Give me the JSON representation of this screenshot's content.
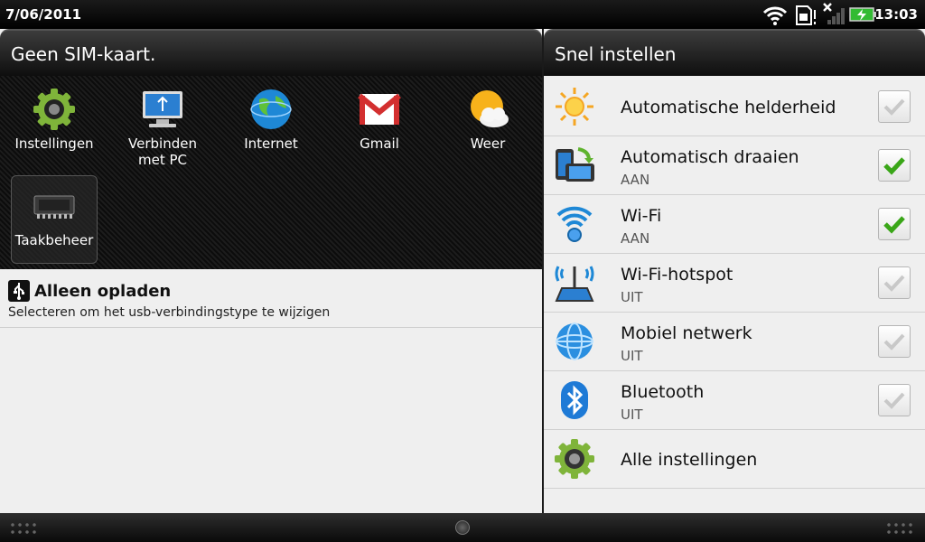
{
  "status_bar": {
    "date": "7/06/2011",
    "time": "13:03",
    "icons": [
      "wifi-icon",
      "sim-card-alert-icon",
      "no-signal-icon",
      "battery-charging-icon"
    ]
  },
  "left_panel": {
    "header": "Geen SIM-kaart.",
    "apps": [
      {
        "label": "Instellingen",
        "icon": "gear-icon"
      },
      {
        "label": "Verbinden met PC",
        "icon": "monitor-usb-icon"
      },
      {
        "label": "Internet",
        "icon": "globe-icon"
      },
      {
        "label": "Gmail",
        "icon": "gmail-icon"
      },
      {
        "label": "Weer",
        "icon": "weather-sun-cloud-icon"
      },
      {
        "label": "Taakbeheer",
        "icon": "memory-chip-icon"
      }
    ],
    "notification": {
      "title": "Alleen opladen",
      "subtitle": "Selecteren om het usb-verbindingstype te wijzigen",
      "icon": "usb-icon"
    }
  },
  "right_panel": {
    "header": "Snel instellen",
    "rows": [
      {
        "title": "Automatische helderheid",
        "subtitle": "",
        "checked": false,
        "icon": "brightness-sun-icon"
      },
      {
        "title": "Automatisch draaien",
        "subtitle": "AAN",
        "checked": true,
        "icon": "rotate-screen-icon"
      },
      {
        "title": "Wi-Fi",
        "subtitle": "AAN",
        "checked": true,
        "icon": "wifi-icon"
      },
      {
        "title": "Wi-Fi-hotspot",
        "subtitle": "UIT",
        "checked": false,
        "icon": "hotspot-icon"
      },
      {
        "title": "Mobiel netwerk",
        "subtitle": "UIT",
        "checked": false,
        "icon": "globe-network-icon"
      },
      {
        "title": "Bluetooth",
        "subtitle": "UIT",
        "checked": false,
        "icon": "bluetooth-icon"
      },
      {
        "title": "Alle instellingen",
        "subtitle": "",
        "icon": "gear-icon"
      }
    ]
  },
  "colors": {
    "check_green": "#3aa618",
    "check_gray": "#c8c8c8",
    "panel_bg": "#efefef"
  }
}
